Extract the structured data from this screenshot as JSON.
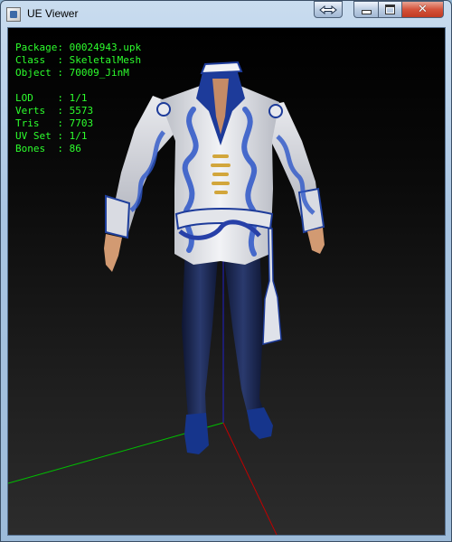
{
  "window": {
    "title": "UE Viewer",
    "icon": "app-icon"
  },
  "controls": {
    "fullscreen_icon": "double-arrow-icon",
    "minimize_icon": "minimize-icon",
    "maximize_icon": "maximize-icon",
    "close_icon": "close-icon"
  },
  "info": {
    "package": "Package: 00024943.upk",
    "class": "Class  : SkeletalMesh",
    "object": "Object : 70009_JinM",
    "lod": "LOD    : 1/1",
    "verts": "Verts  : 5573",
    "tris": "Tris   : 7703",
    "uvset": "UV Set : 1/1",
    "bones": "Bones  : 86"
  },
  "colors": {
    "info_text": "#2dff2d",
    "axis_x": "#00c000",
    "axis_y": "#c00000",
    "axis_z": "#2020c8"
  }
}
